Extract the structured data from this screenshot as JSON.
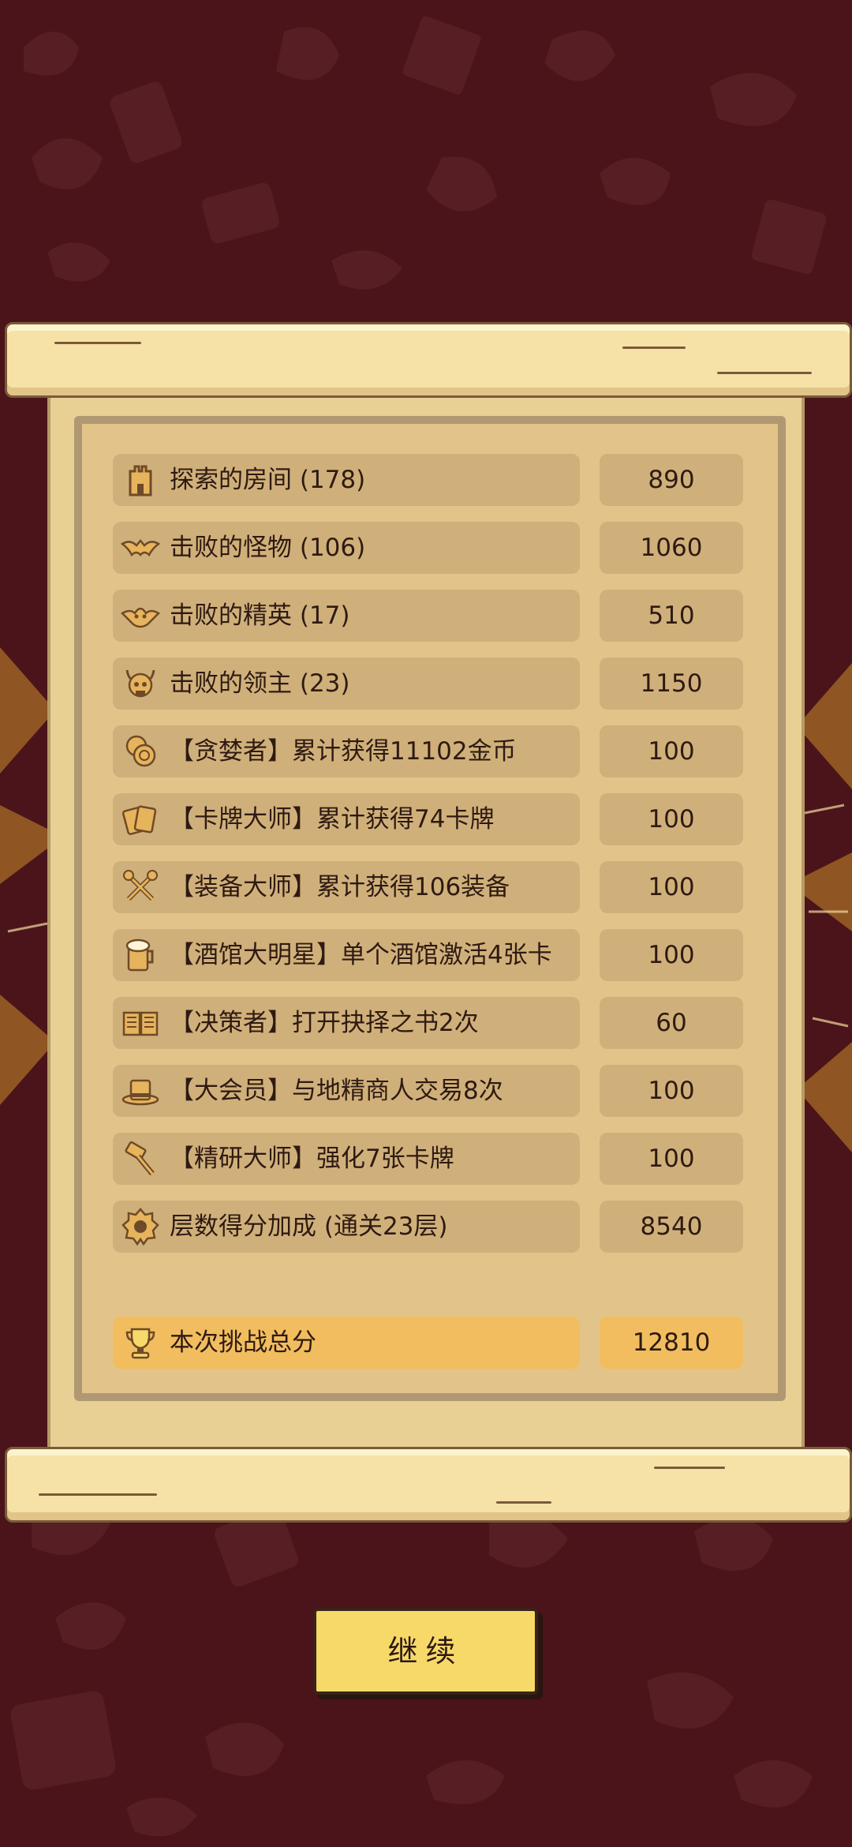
{
  "colors": {
    "background": "#4a141a",
    "paper": "#e8cf94",
    "row": "#d0b07a",
    "total_row": "#f2bd5e",
    "button": "#f7d96a"
  },
  "rows": [
    {
      "icon": "tower-icon",
      "label": "探索的房间 (178)",
      "value": "890"
    },
    {
      "icon": "bat-icon",
      "label": "击败的怪物 (106)",
      "value": "1060"
    },
    {
      "icon": "demon-bat-icon",
      "label": "击败的精英 (17)",
      "value": "510"
    },
    {
      "icon": "horned-skull-icon",
      "label": "击败的领主 (23)",
      "value": "1150"
    },
    {
      "icon": "coins-icon",
      "label": "【贪婪者】累计获得11102金币",
      "value": "100"
    },
    {
      "icon": "cards-icon",
      "label": "【卡牌大师】累计获得74卡牌",
      "value": "100"
    },
    {
      "icon": "crossed-tools-icon",
      "label": "【装备大师】累计获得106装备",
      "value": "100"
    },
    {
      "icon": "beer-mug-icon",
      "label": "【酒馆大明星】单个酒馆激活4张卡",
      "value": "100"
    },
    {
      "icon": "open-book-icon",
      "label": "【决策者】打开抉择之书2次",
      "value": "60"
    },
    {
      "icon": "top-hat-icon",
      "label": "【大会员】与地精商人交易8次",
      "value": "100"
    },
    {
      "icon": "hammer-icon",
      "label": "【精研大师】强化7张卡牌",
      "value": "100"
    },
    {
      "icon": "floor-badge-icon",
      "label": "层数得分加成 (通关23层)",
      "value": "8540"
    }
  ],
  "total": {
    "icon": "trophy-icon",
    "label": "本次挑战总分",
    "value": "12810"
  },
  "continue_button": {
    "label": "继续"
  }
}
